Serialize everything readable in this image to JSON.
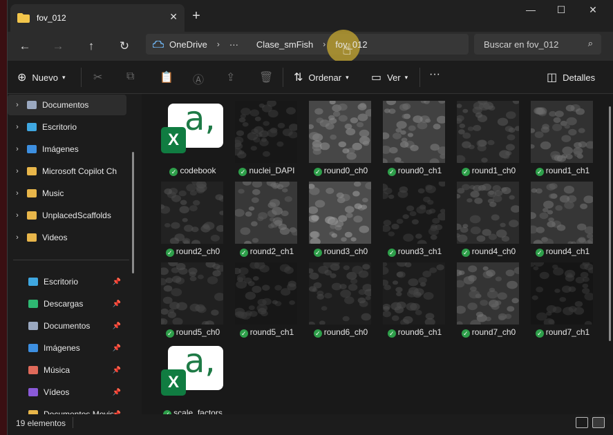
{
  "window": {
    "tab_title": "fov_012",
    "tab_close": "✕",
    "new_tab": "+",
    "minimize": "—",
    "maximize": "☐",
    "close": "✕"
  },
  "nav": {
    "breadcrumbs": [
      "OneDrive",
      "···",
      "Clase_smFish",
      "fov_012"
    ],
    "search_placeholder": "Buscar en fov_012"
  },
  "toolbar": {
    "new_label": "Nuevo",
    "sort_label": "Ordenar",
    "view_label": "Ver",
    "more_label": "···",
    "details_label": "Detalles"
  },
  "sidebar": {
    "tree": [
      {
        "label": "Documentos",
        "color": "#9aa8c0",
        "selected": true
      },
      {
        "label": "Escritorio",
        "color": "#3fa7e0"
      },
      {
        "label": "Imágenes",
        "color": "#3d8fe0"
      },
      {
        "label": "Microsoft Copilot Ch",
        "color": "#e8b64a"
      },
      {
        "label": "Music",
        "color": "#e8b64a"
      },
      {
        "label": "UnplacedScaffolds",
        "color": "#e8b64a"
      },
      {
        "label": "Videos",
        "color": "#e8b64a"
      }
    ],
    "quick": [
      {
        "label": "Escritorio",
        "color": "#3fa7e0"
      },
      {
        "label": "Descargas",
        "color": "#2eb872"
      },
      {
        "label": "Documentos",
        "color": "#9aa8c0"
      },
      {
        "label": "Imágenes",
        "color": "#3d8fe0"
      },
      {
        "label": "Música",
        "color": "#e06a5a"
      },
      {
        "label": "Vídeos",
        "color": "#8a5ad8"
      },
      {
        "label": "Documentos Movis",
        "color": "#e8b64a"
      }
    ]
  },
  "files": [
    {
      "name": "codebook",
      "kind": "excel"
    },
    {
      "name": "nuclei_DAPI",
      "kind": "img",
      "brightness": 0.12
    },
    {
      "name": "round0_ch0",
      "kind": "img",
      "brightness": 0.55
    },
    {
      "name": "round0_ch1",
      "kind": "img",
      "brightness": 0.5
    },
    {
      "name": "round1_ch0",
      "kind": "img",
      "brightness": 0.25
    },
    {
      "name": "round1_ch1",
      "kind": "img",
      "brightness": 0.35
    },
    {
      "name": "round2_ch0",
      "kind": "img",
      "brightness": 0.22
    },
    {
      "name": "round2_ch1",
      "kind": "img",
      "brightness": 0.42
    },
    {
      "name": "round3_ch0",
      "kind": "img",
      "brightness": 0.6
    },
    {
      "name": "round3_ch1",
      "kind": "img",
      "brightness": 0.14
    },
    {
      "name": "round4_ch0",
      "kind": "img",
      "brightness": 0.3
    },
    {
      "name": "round4_ch1",
      "kind": "img",
      "brightness": 0.4
    },
    {
      "name": "round5_ch0",
      "kind": "img",
      "brightness": 0.2
    },
    {
      "name": "round5_ch1",
      "kind": "img",
      "brightness": 0.12
    },
    {
      "name": "round6_ch0",
      "kind": "img",
      "brightness": 0.18
    },
    {
      "name": "round6_ch1",
      "kind": "img",
      "brightness": 0.17
    },
    {
      "name": "round7_ch0",
      "kind": "img",
      "brightness": 0.38
    },
    {
      "name": "round7_ch1",
      "kind": "img",
      "brightness": 0.1
    },
    {
      "name": "scale_factors",
      "kind": "excel"
    }
  ],
  "status": {
    "count": "19 elementos"
  }
}
